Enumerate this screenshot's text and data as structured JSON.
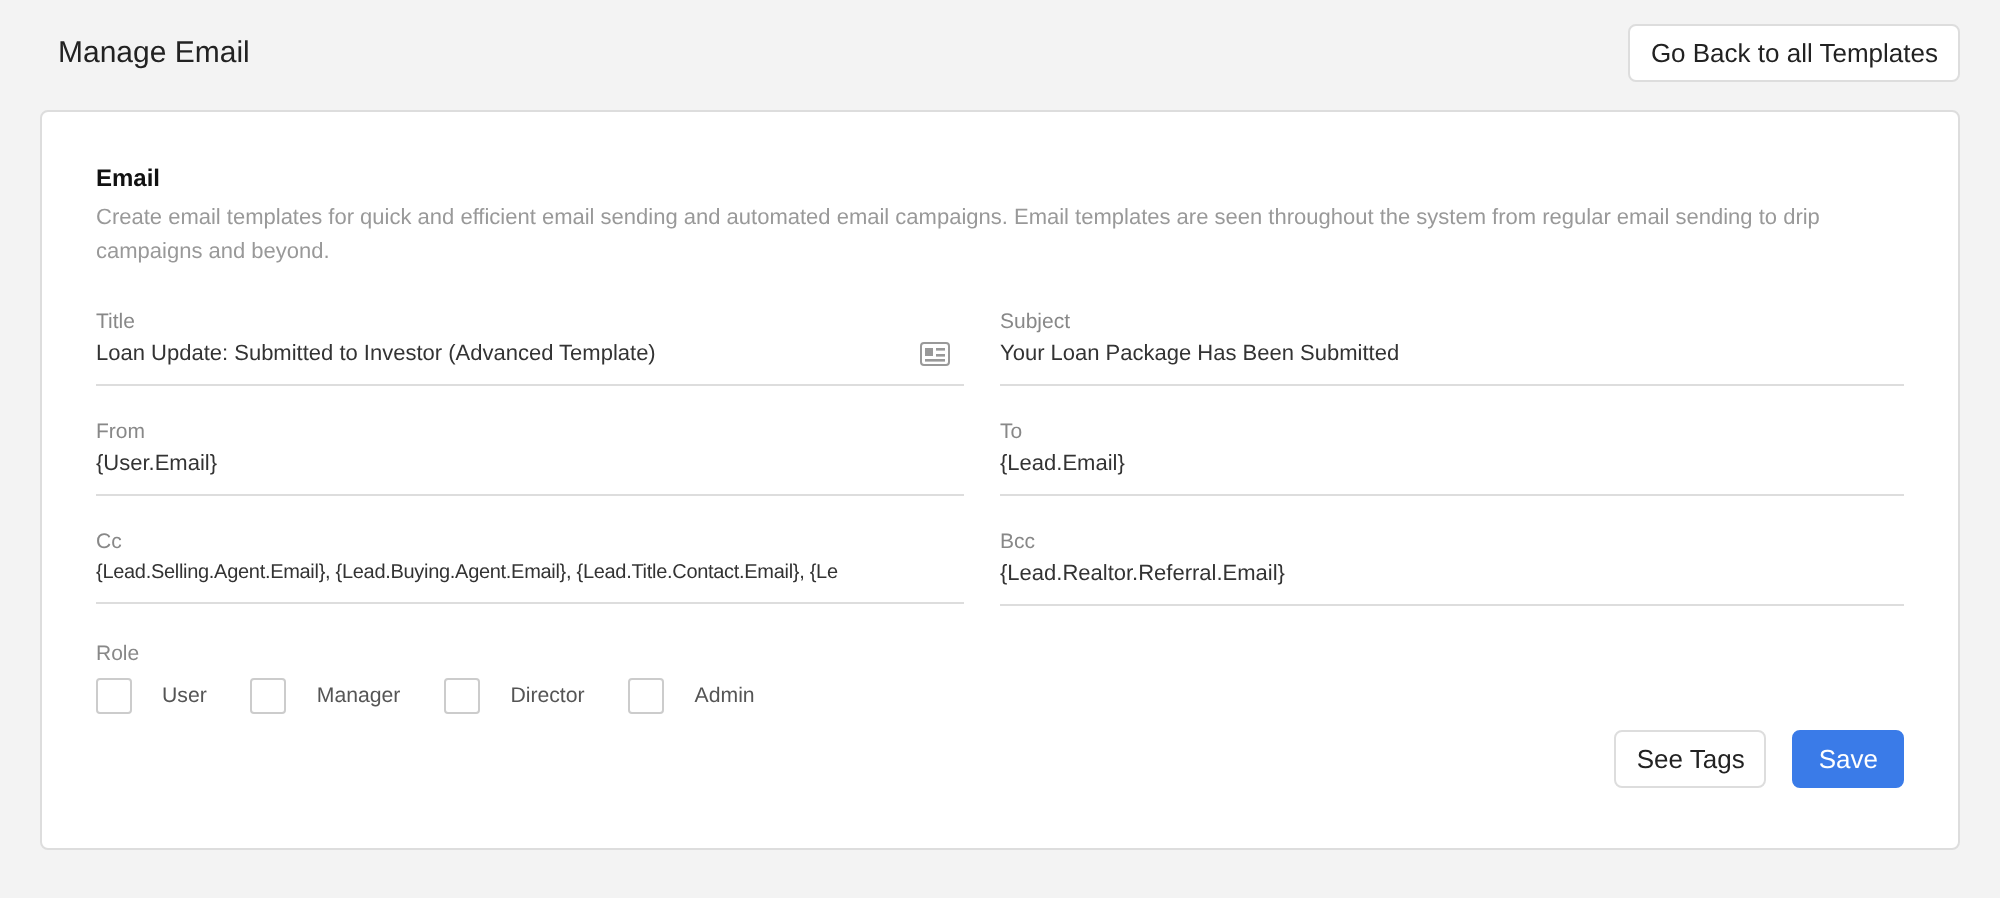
{
  "header": {
    "title": "Manage Email",
    "back_button": "Go Back to all Templates"
  },
  "card": {
    "heading": "Email",
    "description": "Create email templates for quick and efficient email sending and automated email campaigns. Email templates are seen throughout the system from regular email sending to drip campaigns and beyond."
  },
  "fields": [
    {
      "label": "Title",
      "value": "Loan Update: Submitted to Investor (Advanced Template)",
      "kind": "with-icon"
    },
    {
      "label": "Subject",
      "value": "Your Loan Package Has Been Submitted",
      "kind": "plain"
    },
    {
      "label": "From",
      "value": "{User.Email}",
      "kind": "plain"
    },
    {
      "label": "To",
      "value": "{Lead.Email}",
      "kind": "plain"
    },
    {
      "label": "Cc",
      "value": "{Lead.Selling.Agent.Email}, {Lead.Buying.Agent.Email}, {Lead.Title.Contact.Email}, {Le",
      "kind": "long"
    },
    {
      "label": "Bcc",
      "value": "{Lead.Realtor.Referral.Email}",
      "kind": "plain"
    }
  ],
  "role": {
    "label": "Role",
    "options": [
      {
        "label": "User",
        "checked": false
      },
      {
        "label": "Manager",
        "checked": false
      },
      {
        "label": "Director",
        "checked": false
      },
      {
        "label": "Admin",
        "checked": false
      }
    ]
  },
  "buttons": [
    {
      "label": "See Tags",
      "kind": "secondary"
    },
    {
      "label": "Save",
      "kind": "primary"
    }
  ]
}
